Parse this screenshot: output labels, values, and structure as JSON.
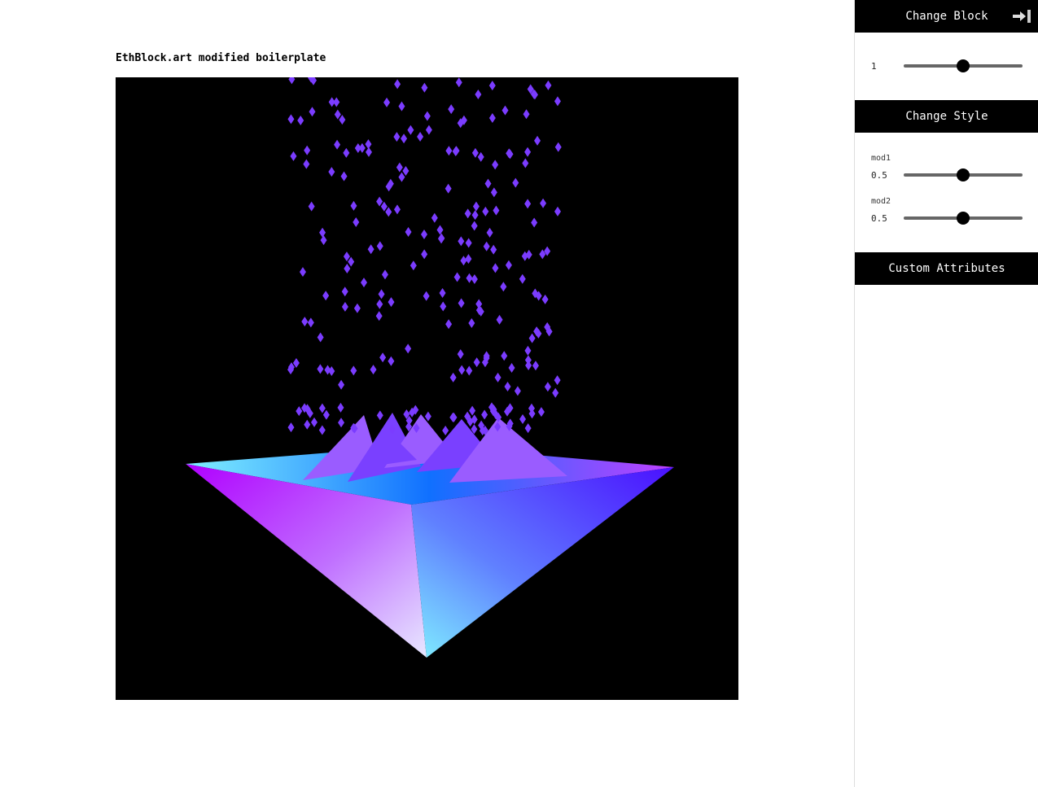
{
  "page": {
    "title": "EthBlock.art modified boilerplate"
  },
  "canvas": {
    "colors": {
      "background": "#000000",
      "particle": "#7b3cff",
      "pyramid_left": "#b000ff",
      "pyramid_right": "#4a1cff",
      "pyramid_tip": "#7fe8ff"
    }
  },
  "panel": {
    "change_block": {
      "label": "Change Block",
      "collapse_icon": "arrow-right-to-bar-icon",
      "value": "1",
      "fraction": 0.5
    },
    "change_style": {
      "label": "Change Style",
      "mods": [
        {
          "name": "mod1",
          "value": "0.5",
          "fraction": 0.5
        },
        {
          "name": "mod2",
          "value": "0.5",
          "fraction": 0.5
        }
      ]
    },
    "custom_attributes": {
      "label": "Custom Attributes"
    }
  }
}
